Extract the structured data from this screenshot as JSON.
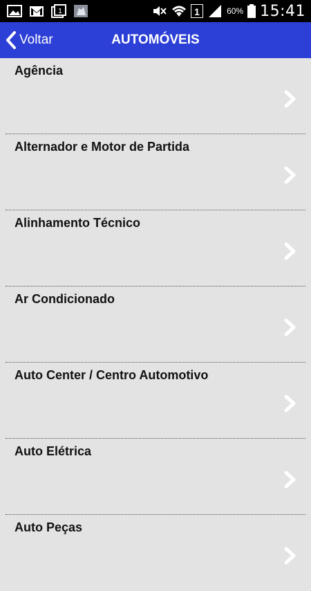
{
  "status_bar": {
    "battery_percent": "60%",
    "time": "15:41",
    "sim_number": "1",
    "icons": [
      "image-icon",
      "gmail-icon",
      "notification-1-icon",
      "app-icon",
      "mute-icon",
      "wifi-icon",
      "signal-icon",
      "battery-icon"
    ]
  },
  "header": {
    "back_label": "Voltar",
    "title": "AUTOMÓVEIS",
    "color": "#2c3fd6"
  },
  "categories": [
    {
      "label": "Agência"
    },
    {
      "label": "Alternador e Motor de Partida"
    },
    {
      "label": "Alinhamento Técnico"
    },
    {
      "label": "Ar Condicionado"
    },
    {
      "label": "Auto Center / Centro Automotivo"
    },
    {
      "label": "Auto Elétrica"
    },
    {
      "label": "Auto Peças"
    }
  ]
}
